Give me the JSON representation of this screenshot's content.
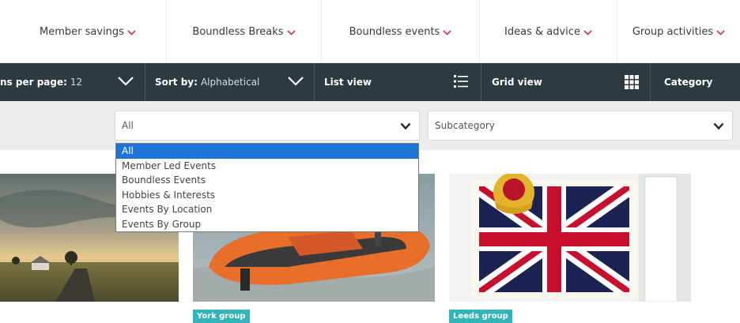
{
  "nav": {
    "items": [
      {
        "label": "Member savings"
      },
      {
        "label": "Boundless Breaks"
      },
      {
        "label": "Boundless events"
      },
      {
        "label": "Ideas & advice"
      },
      {
        "label": "Group activities"
      }
    ],
    "caret_color": "#e0245e"
  },
  "toolbar": {
    "per_page_label": "ns per page:",
    "per_page_value": "12",
    "sort_label": "Sort by:",
    "sort_value": "Alphabetical",
    "list_view_label": "List view",
    "grid_view_label": "Grid view",
    "category_label": "Category",
    "background": "#2d3a40"
  },
  "filters": {
    "category_select_value": "All",
    "subcategory_select_value": "Subcategory"
  },
  "dropdown": {
    "options": [
      {
        "label": "All",
        "selected": true
      },
      {
        "label": "Member Led Events",
        "selected": false
      },
      {
        "label": "Boundless Events",
        "selected": false
      },
      {
        "label": "Hobbies & Interests",
        "selected": false
      },
      {
        "label": "Events By Location",
        "selected": false
      },
      {
        "label": "Events By Group",
        "selected": false
      }
    ],
    "highlight_color": "#1e73d6"
  },
  "cards": [
    {
      "image": "countryside-landscape",
      "tag": ""
    },
    {
      "image": "orange-lifeboat",
      "tag": "York group"
    },
    {
      "image": "union-jack-cake",
      "tag": "Leeds group"
    }
  ],
  "tag_color": "#33b4b8"
}
